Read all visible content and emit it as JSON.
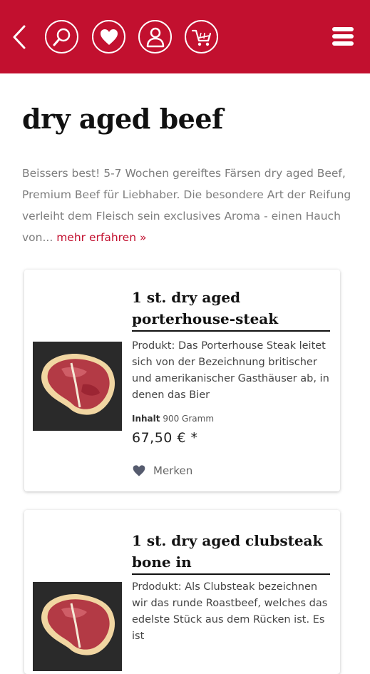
{
  "header": {
    "icons": [
      "back-icon",
      "search-icon",
      "heart-icon",
      "user-icon",
      "cart-icon",
      "menu-icon"
    ],
    "brand_color": "#c2102f"
  },
  "category": {
    "title": "dry aged beef",
    "description": "Beissers best! 5-7 Wochen gereiftes Färsen dry aged Beef, Premium Beef für Liebhaber. Die besondere Art der Reifung verleiht dem Fleisch sein exclusives Aroma - einen Hauch von...",
    "more_link": "mehr erfahren »"
  },
  "products": [
    {
      "title": "1 st. dry aged porterhouse-steak",
      "description": "Produkt: Das Porterhouse Steak leitet sich von der Bezeichnung britischer und amerikanischer Gasthäuser ab, in denen das Bier",
      "content_label": "Inhalt",
      "content_value": "900 Gramm",
      "price": "67,50 € *",
      "wishlist_label": "Merken"
    },
    {
      "title": "1 st. dry aged clubsteak bone in",
      "description": "Prdodukt: Als Clubsteak bezeichnen wir das runde Roastbeef, welches das edelste Stück aus dem Rücken ist. Es ist"
    }
  ]
}
